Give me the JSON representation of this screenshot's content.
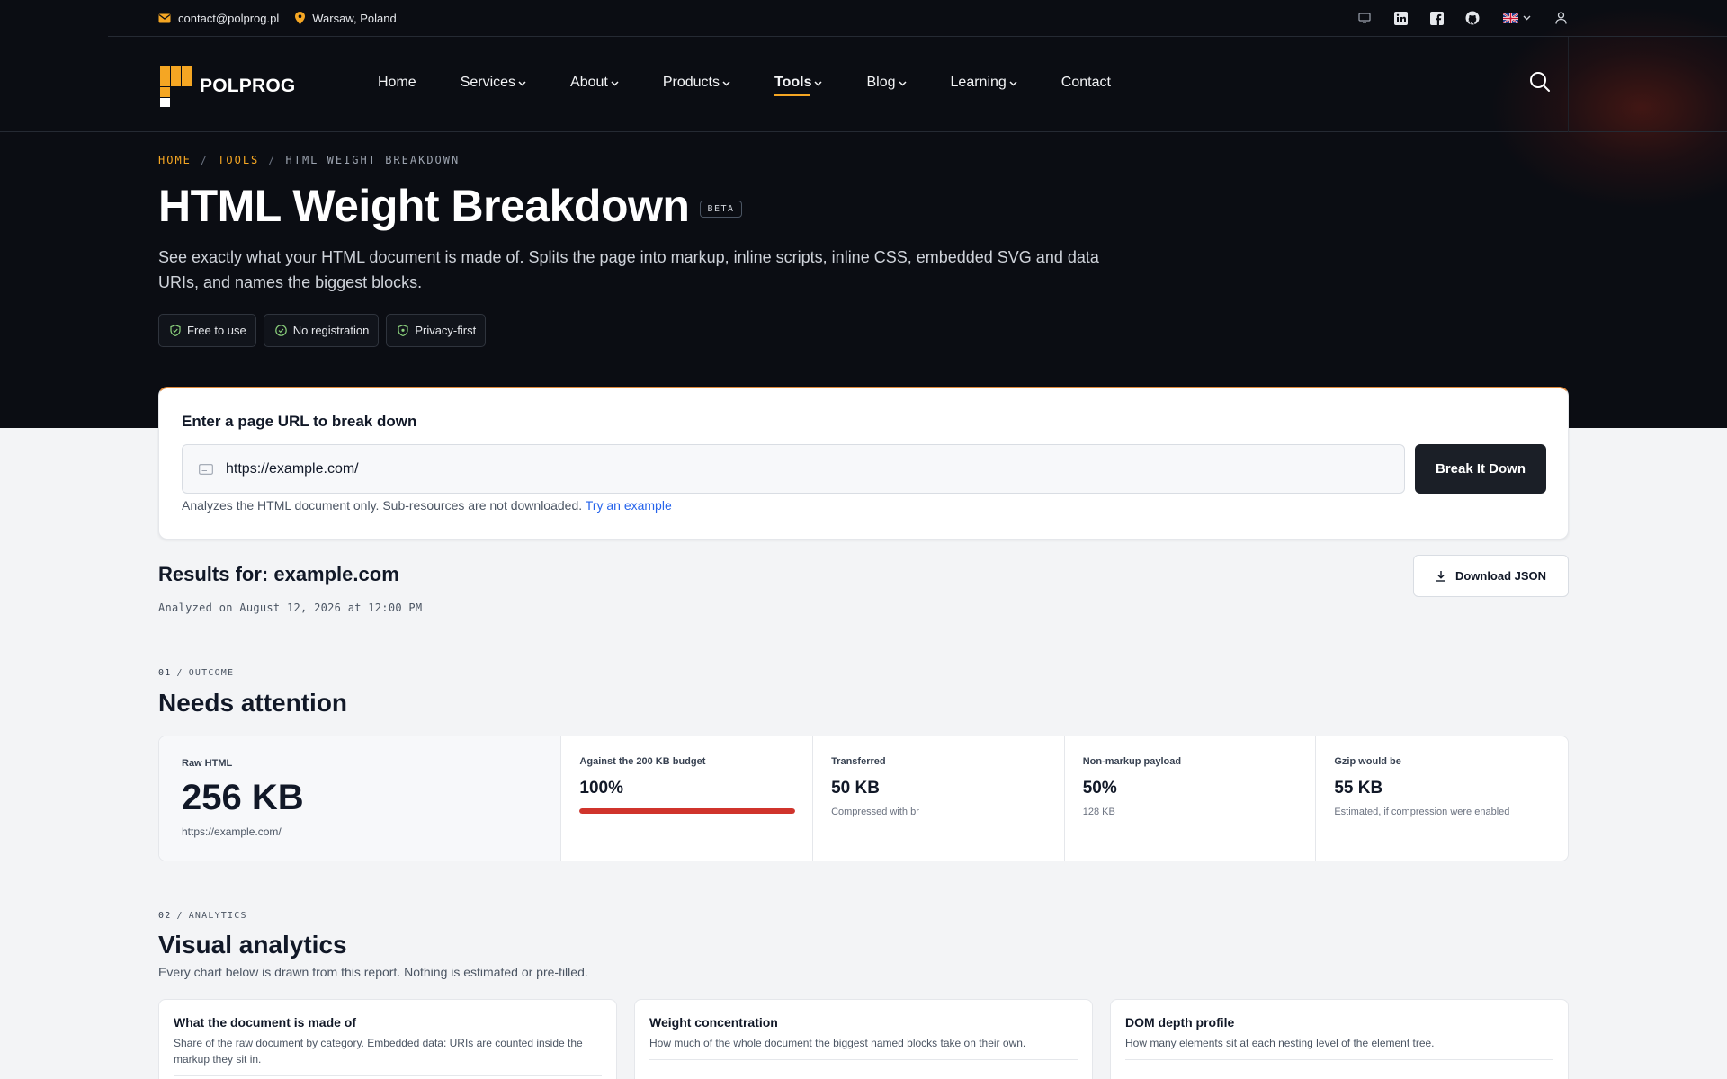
{
  "colors": {
    "accent": "#f5a623",
    "danger": "#d0342c",
    "hero_bg": "#0b0d13",
    "link": "#2563eb"
  },
  "topbar": {
    "email": "contact@polprog.pl",
    "location": "Warsaw, Poland",
    "icons": [
      "monitor-icon",
      "linkedin-icon",
      "facebook-icon",
      "github-icon",
      "uk-flag-icon",
      "user-icon"
    ]
  },
  "nav": {
    "logo": "POLPROG",
    "items": [
      {
        "label": "Home",
        "dropdown": false
      },
      {
        "label": "Services",
        "dropdown": true
      },
      {
        "label": "About",
        "dropdown": true
      },
      {
        "label": "Products",
        "dropdown": true
      },
      {
        "label": "Tools",
        "dropdown": true,
        "active": true
      },
      {
        "label": "Blog",
        "dropdown": true
      },
      {
        "label": "Learning",
        "dropdown": true
      },
      {
        "label": "Contact",
        "dropdown": false
      }
    ]
  },
  "breadcrumb": [
    "HOME",
    "TOOLS",
    "HTML WEIGHT BREAKDOWN"
  ],
  "hero": {
    "title": "HTML Weight Breakdown",
    "badge": "BETA",
    "description": "See exactly what your HTML document is made of. Splits the page into markup, inline scripts, inline CSS, embedded SVG and data URIs, and names the biggest blocks.",
    "tags": [
      "Free to use",
      "No registration",
      "Privacy-first"
    ]
  },
  "form": {
    "title": "Enter a page URL to break down",
    "url_value": "https://example.com/",
    "button": "Break It Down",
    "hint": "Analyzes the HTML document only. Sub-resources are not downloaded.",
    "hint_link": "Try an example"
  },
  "results": {
    "title": "Results for: example.com",
    "date": "Analyzed on August 12, 2026 at 12:00 PM",
    "download": "Download JSON"
  },
  "outcome": {
    "num": "01",
    "eyebrow": "OUTCOME",
    "title": "Needs attention",
    "main": {
      "label": "Raw HTML",
      "value": "256 KB",
      "sub": "https://example.com/"
    },
    "budget": {
      "label": "Against the 200 KB budget",
      "value": "100%",
      "fraction": 1.0
    },
    "transferred": {
      "label": "Transferred",
      "value": "50 KB",
      "sub": "Compressed with br"
    },
    "nonmarkup": {
      "label": "Non-markup payload",
      "value": "50%",
      "sub": "128 KB"
    },
    "gzip": {
      "label": "Gzip would be",
      "value": "55 KB",
      "sub": "Estimated, if compression were enabled"
    }
  },
  "analytics": {
    "num": "02",
    "eyebrow": "ANALYTICS",
    "title": "Visual analytics",
    "description": "Every chart below is drawn from this report. Nothing is estimated or pre-filled.",
    "cards": [
      {
        "title": "What the document is made of",
        "description": "Share of the raw document by category. Embedded data: URIs are counted inside the markup they sit in."
      },
      {
        "title": "Weight concentration",
        "description": "How much of the whole document the biggest named blocks take on their own."
      },
      {
        "title": "DOM depth profile",
        "description": "How many elements sit at each nesting level of the element tree."
      }
    ]
  }
}
